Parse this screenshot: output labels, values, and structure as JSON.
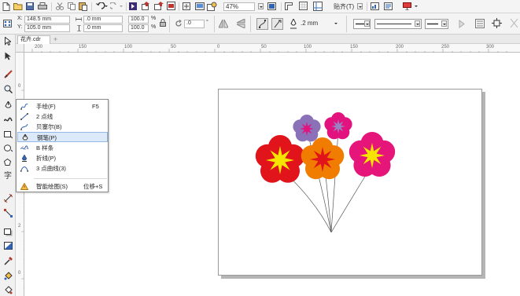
{
  "toolbar_top": {
    "zoom": "47%",
    "snap_label": "贴齐(T)"
  },
  "property_bar": {
    "x_label": "X:",
    "x_value": "148.5 mm",
    "y_label": "Y:",
    "y_value": "105.0 mm",
    "width_value": ".0 mm",
    "height_value": ".0 mm",
    "scale_x": "100.0",
    "scale_y": "100.0",
    "pct": "%",
    "rotation": ".0",
    "outline_width": ".2 mm"
  },
  "document_tab": {
    "label": "花卉.cdr",
    "add_label": "+"
  },
  "ruler": {
    "h_labels": [
      "200",
      "150",
      "100",
      "50",
      "0",
      "50",
      "100",
      "150",
      "200",
      "250",
      "300"
    ],
    "v_labels": [
      "0",
      "5",
      "1",
      "2",
      "1",
      "0",
      "0",
      "5",
      "0"
    ]
  },
  "flyout_menu": {
    "items": [
      {
        "label": "手绘(F)",
        "shortcut": "F5"
      },
      {
        "label": "2 点线",
        "shortcut": ""
      },
      {
        "label": "贝塞尔(B)",
        "shortcut": ""
      },
      {
        "label": "钢笔(P)",
        "shortcut": "",
        "selected": true
      },
      {
        "label": "B 样条",
        "shortcut": ""
      },
      {
        "label": "折线(P)",
        "shortcut": ""
      },
      {
        "label": "3 点曲线(3)",
        "shortcut": ""
      },
      {
        "label": "智能绘图(S)",
        "shortcut": "位移+S"
      }
    ]
  },
  "artwork": {
    "flowers": [
      {
        "petal_color": "#e1131b",
        "star_color": "#f6e500"
      },
      {
        "petal_color": "#f07d00",
        "star_color": "#e1131b"
      },
      {
        "petal_color": "#e6157a",
        "star_color": "#f6e500"
      },
      {
        "petal_color": "#8b72b8",
        "star_color": "#e2127f"
      },
      {
        "petal_color": "#e2127f",
        "star_color": "#9a82c2"
      }
    ],
    "stem_color": "#555555"
  },
  "icons": [
    "new-document-icon",
    "open-icon",
    "save-icon",
    "print-icon",
    "cut-icon",
    "copy-icon",
    "paste-icon",
    "undo-icon",
    "redo-icon",
    "corel-connect-icon",
    "import-icon",
    "export-icon",
    "publish-pdf-icon",
    "zoom-dropdown-icon",
    "full-screen-icon",
    "show-rulers-icon",
    "show-grid-icon",
    "show-guidelines-icon",
    "snap-dropdown-icon",
    "options-icon",
    "application-launcher-icon",
    "pick-tool-icon",
    "shape-tool-icon",
    "crop-tool-icon",
    "zoom-tool-icon",
    "freehand-tool-icon",
    "artistic-media-icon",
    "rectangle-tool-icon",
    "ellipse-tool-icon",
    "polygon-tool-icon",
    "text-tool-icon",
    "parallel-dimension-icon",
    "straight-line-connector-icon",
    "drop-shadow-icon",
    "transparency-icon",
    "eyedropper-icon",
    "interactive-fill-icon",
    "smart-fill-icon"
  ]
}
